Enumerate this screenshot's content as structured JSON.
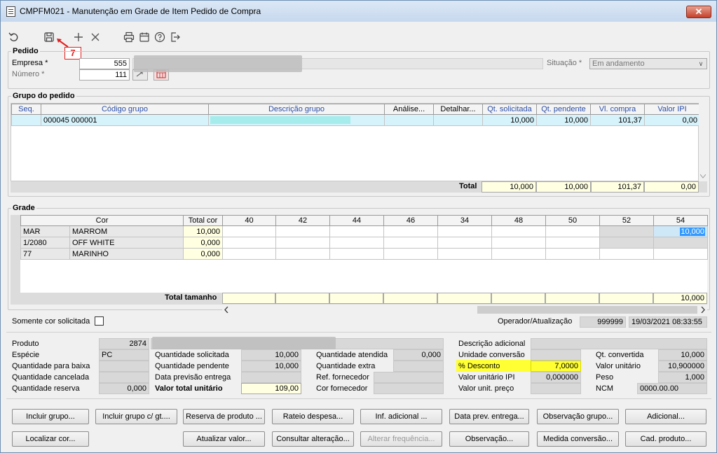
{
  "window": {
    "title": "CMPFM021 - Manutenção em Grade de Item Pedido de Compra",
    "close_label": "✕"
  },
  "annotation": {
    "step": "7"
  },
  "pedido": {
    "legend": "Pedido",
    "empresa_label": "Empresa *",
    "empresa_value": "555",
    "numero_label": "Número *",
    "numero_value": "111",
    "situacao_label": "Situação *",
    "situacao_value": "Em andamento"
  },
  "grupo": {
    "legend": "Grupo do pedido",
    "columns": [
      "Seq.",
      "Código grupo",
      "Descrição grupo",
      "Análise...",
      "Detalhar...",
      "Qt. solicitada",
      "Qt. pendente",
      "Vl. compra",
      "Valor IPI"
    ],
    "rows": [
      {
        "seq": "",
        "codigo": "000045 000001",
        "descricao": "",
        "analise": "",
        "detalhar": "",
        "qt_solicitada": "10,000",
        "qt_pendente": "10,000",
        "vl_compra": "101,37",
        "valor_ipi": "0,00"
      }
    ],
    "total_label": "Total",
    "totals": {
      "qt_solicitada": "10,000",
      "qt_pendente": "10,000",
      "vl_compra": "101,37",
      "valor_ipi": "0,00"
    }
  },
  "grade": {
    "legend": "Grade",
    "cor_header": "Cor",
    "total_cor_header": "Total cor",
    "sizes": [
      "40",
      "42",
      "44",
      "46",
      "34",
      "48",
      "50",
      "52",
      "54"
    ],
    "rows": [
      {
        "code": "MAR",
        "name": "MARROM",
        "total": "10,000",
        "cells": [
          "",
          "",
          "",
          "",
          "",
          "",
          "",
          "",
          "10,000"
        ]
      },
      {
        "code": "1/2080",
        "name": "OFF WHITE",
        "total": "0,000",
        "cells": [
          "",
          "",
          "",
          "",
          "",
          "",
          "",
          "",
          ""
        ]
      },
      {
        "code": "77",
        "name": "MARINHO",
        "total": "0,000",
        "cells": [
          "",
          "",
          "",
          "",
          "",
          "",
          "",
          "",
          ""
        ]
      }
    ],
    "total_tamanho_label": "Total tamanho",
    "total_tamanho": [
      "",
      "",
      "",
      "",
      "",
      "",
      "",
      "",
      "10,000"
    ]
  },
  "options": {
    "somente_cor_label": "Somente cor solicitada",
    "operador_label": "Operador/Atualização",
    "operador_value": "999999",
    "atualizacao_value": "19/03/2021 08:33:55"
  },
  "detalhes": {
    "produto_label": "Produto",
    "produto_value": "2874",
    "especie_label": "Espécie",
    "especie_value": "PC",
    "qt_baixa_label": "Quantidade para baixa",
    "qt_cancelada_label": "Quantidade cancelada",
    "qt_reserva_label": "Quantidade reserva",
    "qt_reserva_value": "0,000",
    "qt_solicitada_label": "Quantidade solicitada",
    "qt_solicitada_value": "10,000",
    "qt_pendente_label": "Quantidade pendente",
    "qt_pendente_value": "10,000",
    "data_previsao_label": "Data previsão entrega",
    "valor_total_label": "Valor total unitário",
    "valor_total_value": "109,00",
    "qt_atendida_label": "Quantidade atendida",
    "qt_atendida_value": "0,000",
    "qt_extra_label": "Quantidade extra",
    "ref_fornecedor_label": "Ref. fornecedor",
    "cor_fornecedor_label": "Cor fornecedor",
    "descricao_adicional_label": "Descrição adicional",
    "unidade_conversao_label": "Unidade conversão",
    "desconto_label": "% Desconto",
    "desconto_value": "7,0000",
    "valor_unit_ipi_label": "Valor unitário IPI",
    "valor_unit_ipi_value": "0,000000",
    "valor_unit_preco_label": "Valor unit. preço",
    "qt_convertida_label": "Qt. convertida",
    "qt_convertida_value": "10,000",
    "valor_unitario_label": "Valor unitário",
    "valor_unitario_value": "10,900000",
    "peso_label": "Peso",
    "peso_value": "1,000",
    "ncm_label": "NCM",
    "ncm_value": "0000.00.00"
  },
  "buttons": {
    "incluir_grupo": "Incluir grupo...",
    "incluir_grupo_gt": "Incluir grupo c/ gt....",
    "reserva_produto": "Reserva de produto ...",
    "rateio_despesa": "Rateio despesa...",
    "inf_adicional": "Inf. adicional ...",
    "data_prev_entrega": "Data prev. entrega...",
    "observacao_grupo": "Observação grupo...",
    "adicional": "Adicional...",
    "localizar_cor": "Localizar cor...",
    "atualizar_valor": "Atualizar valor...",
    "consultar_alteracao": "Consultar alteração...",
    "alterar_frequencia": "Alterar frequência...",
    "observacao": "Observação...",
    "medida_conversao": "Medida conversão...",
    "cad_produto": "Cad. produto..."
  },
  "colors": {
    "highlight": "#ffff33",
    "selected_row": "#d6f2fa",
    "total_cell": "#ffffe1",
    "annotation": "#e02020"
  }
}
